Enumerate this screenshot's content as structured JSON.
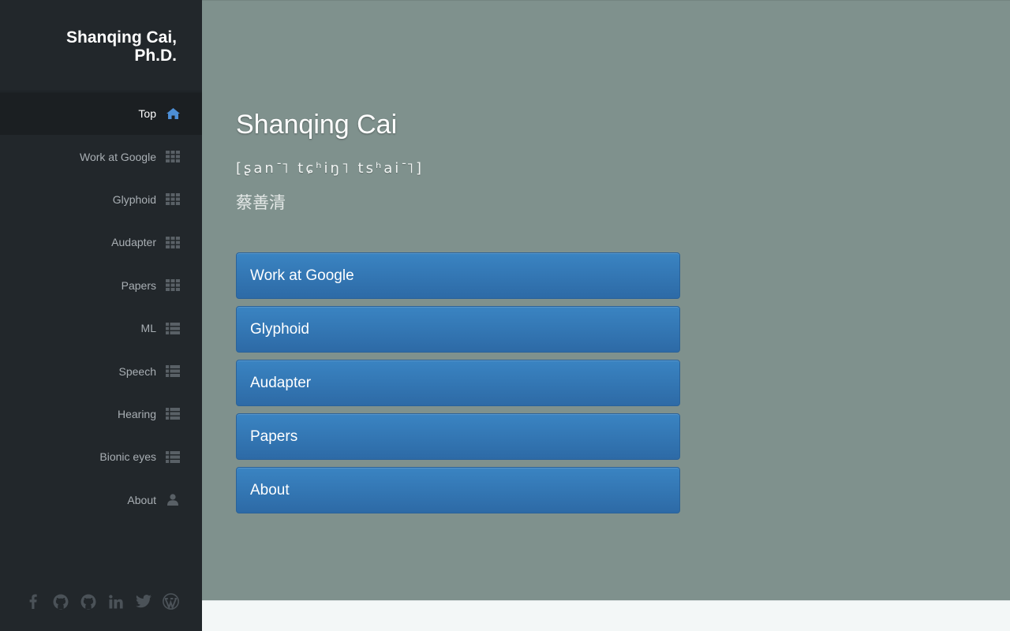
{
  "sidebar": {
    "brand_line1": "Shanqing Cai,",
    "brand_line2": "Ph.D.",
    "items": [
      {
        "label": "Top",
        "icon": "home-icon"
      },
      {
        "label": "Work at Google",
        "icon": "grid-icon"
      },
      {
        "label": "Glyphoid",
        "icon": "grid-icon"
      },
      {
        "label": "Audapter",
        "icon": "grid-icon"
      },
      {
        "label": "Papers",
        "icon": "grid-icon"
      },
      {
        "label": "ML",
        "icon": "list-icon"
      },
      {
        "label": "Speech",
        "icon": "list-icon"
      },
      {
        "label": "Hearing",
        "icon": "list-icon"
      },
      {
        "label": "Bionic eyes",
        "icon": "list-icon"
      },
      {
        "label": "About",
        "icon": "user-icon"
      }
    ],
    "social": [
      "facebook-icon",
      "github-icon",
      "github-icon",
      "linkedin-icon",
      "twitter-icon",
      "wordpress-icon"
    ]
  },
  "main": {
    "title": "Shanqing Cai",
    "ipa": "[ʂan˥˥ tɕʰiŋ˥ tsʰai˥˥]",
    "hanzi": "蔡善清",
    "buttons": [
      "Work at Google",
      "Glyphoid",
      "Audapter",
      "Papers",
      "About"
    ]
  },
  "colors": {
    "sidebar_bg": "#22272b",
    "main_bg": "#7f918d",
    "button_bg": "#337ab7",
    "active_icon": "#4d8fd6",
    "inactive_icon": "#596066"
  }
}
